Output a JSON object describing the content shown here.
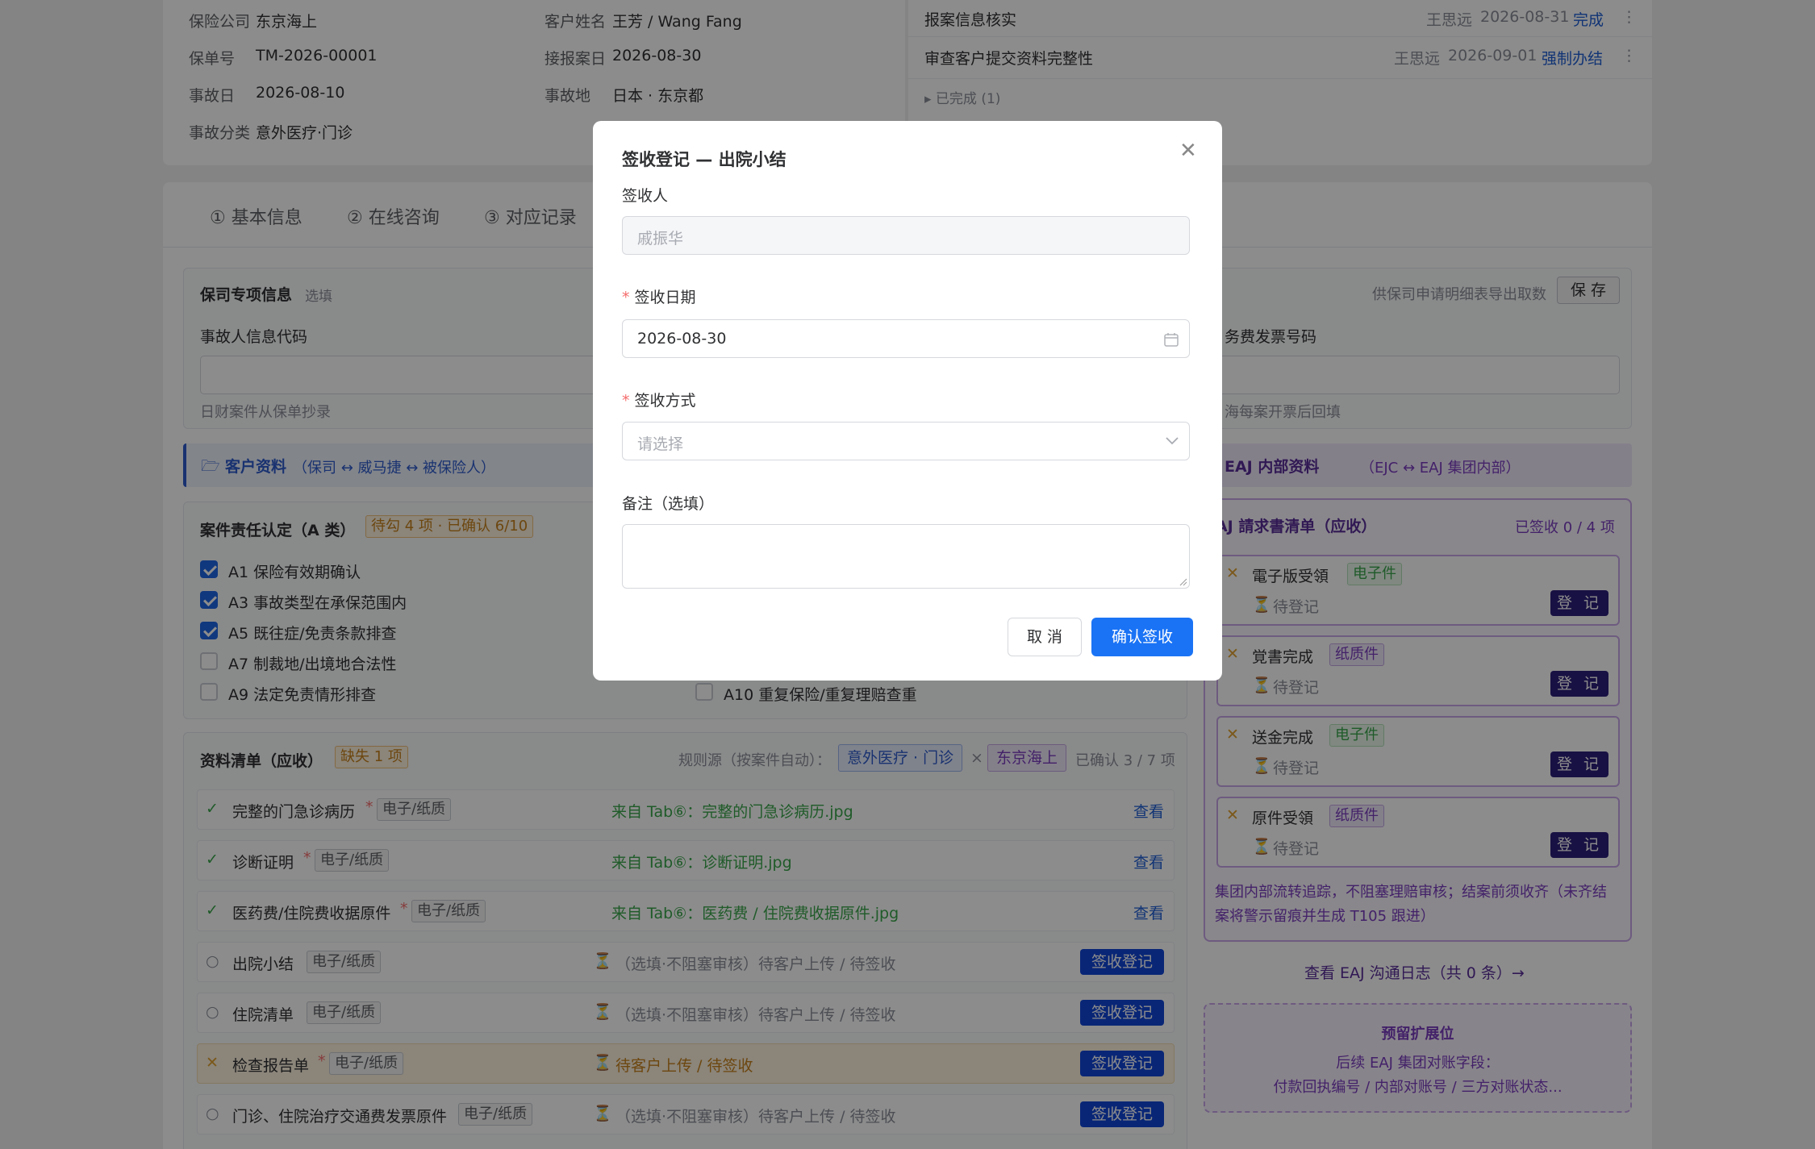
{
  "policy": {
    "insurer_label": "保险公司",
    "insurer": "东京海上",
    "customer_label": "客户姓名",
    "customer": "王芳 / Wang Fang",
    "policy_no_label": "保单号",
    "policy_no": "TM-2026-00001",
    "report_date_label": "接报案日",
    "report_date": "2026-08-30",
    "accident_date_label": "事故日",
    "accident_date": "2026-08-10",
    "accident_place_label": "事故地",
    "accident_place": "日本 · 东京都",
    "category_label": "事故分类",
    "category": "意外医疗·门诊"
  },
  "tasks": [
    {
      "name": "报案信息核实",
      "user": "王思远",
      "date": "2026-08-31",
      "action": "完成"
    },
    {
      "name": "审查客户提交资料完整性",
      "user": "王思远",
      "date": "2026-09-01",
      "action": "强制办结"
    }
  ],
  "tasks_done": "▸ 已完成 (1)",
  "tabs": [
    "① 基本信息",
    "② 在线咨询",
    "③ 对应记录"
  ],
  "insurer_section": {
    "title": "保司专项信息",
    "optional": "选填",
    "right_note": "供保司申请明细表导出取数",
    "save": "保 存",
    "field1_label": "事故人信息代码",
    "field1_hint": "日财案件从保单抄录",
    "field2_label": "务费发票号码",
    "field2_hint": "海每案开票后回填"
  },
  "customer_bar": {
    "title": "客户资料",
    "sub": "（保司 ↔ 威马捷 ↔ 被保险人）"
  },
  "eaj_bar": {
    "title": "EAJ 内部资料",
    "sub": "（EJC ↔ EAJ 集团内部）"
  },
  "liability": {
    "title": "案件责任认定（A 类）",
    "badge": "待勾 4 项 · 已确认 6/10",
    "items": [
      {
        "label": "A1 保险有效期确认",
        "checked": true
      },
      {
        "label": "A3 事故类型在承保范围内",
        "checked": true
      },
      {
        "label": "A5 既往症/免责条款排查",
        "checked": true
      },
      {
        "label": "A7 制裁地/出境地合法性",
        "checked": false
      },
      {
        "label": "A9 法定免责情形排查",
        "checked": false
      }
    ],
    "a10": "A10 重复保险/重复理赔查重"
  },
  "docs": {
    "title": "资料清单（应收）",
    "badge": "缺失 1 项",
    "rule_label": "规则源（按案件自动）：",
    "rule1": "意外医疗 · 门诊",
    "times": "×",
    "rule2": "东京海上",
    "confirmed": "已确认 3 / 7 项",
    "type_tag": "电子/纸质",
    "view": "查看",
    "register": "签收登记",
    "rows": [
      {
        "status": "✓",
        "name": "完整的门急诊病历",
        "req": "*",
        "note": "来自 Tab⑥：完整的门急诊病历.jpg"
      },
      {
        "status": "✓",
        "name": "诊断证明",
        "req": "*",
        "note": "来自 Tab⑥：诊断证明.jpg"
      },
      {
        "status": "✓",
        "name": "医药费/住院费收据原件",
        "req": "*",
        "note": "来自 Tab⑥：医药费 / 住院费收据原件.jpg"
      },
      {
        "status": "○",
        "name": "出院小结",
        "req": "",
        "note": "（选填·不阻塞审核）待客户上传 / 待签收"
      },
      {
        "status": "○",
        "name": "住院清单",
        "req": "",
        "note": "（选填·不阻塞审核）待客户上传 / 待签收"
      },
      {
        "status": "✕",
        "name": "检查报告单",
        "req": "*",
        "note": "待客户上传 / 待签收"
      },
      {
        "status": "○",
        "name": "门诊、住院治疗交通费发票原件",
        "req": "",
        "note": "（选填·不阻塞审核）待客户上传 / 待签收"
      }
    ]
  },
  "eaj": {
    "title": "EAJ 請求書清单（应收）",
    "count": "已签收 0 / 4 项",
    "pending": "待登记",
    "register": "登 记",
    "items": [
      {
        "name": "電子版受領",
        "tag": "电子件"
      },
      {
        "name": "覚書完成",
        "tag": "纸质件"
      },
      {
        "name": "送金完成",
        "tag": "电子件"
      },
      {
        "name": "原件受領",
        "tag": "纸质件"
      }
    ],
    "note1": "集团内部流转追踪，不阻塞理赔审核；结案前须收齐（未齐结",
    "note2": "案将警示留痕并生成 T105 跟进）",
    "log_link": "查看 EAJ 沟通日志（共 0 条）→",
    "reserve_title": "预留扩展位",
    "reserve_line1": "后续 EAJ 集团对账字段：",
    "reserve_line2": "付款回执编号 / 内部对账号 / 三方对账状态..."
  },
  "modal": {
    "title": "签收登记 — 出院小结",
    "signer_label": "签收人",
    "signer_value": "戚振华",
    "date_label": "签收日期",
    "date_value": "2026-08-30",
    "method_label": "签收方式",
    "method_placeholder": "请选择",
    "remark_label": "备注（选填）",
    "cancel": "取 消",
    "confirm": "确认签收"
  }
}
